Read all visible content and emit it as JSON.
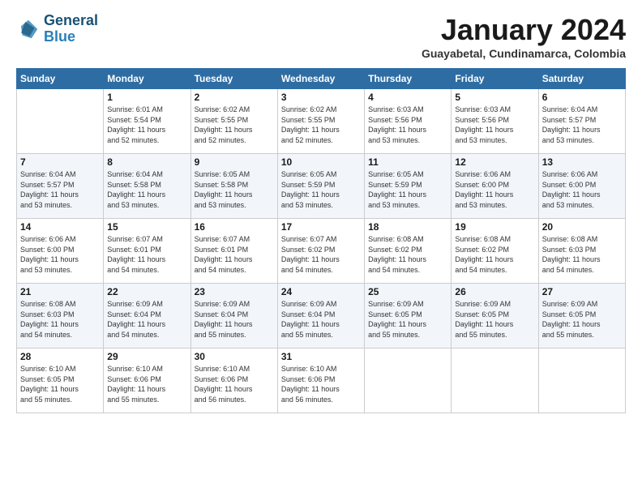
{
  "header": {
    "logo_line1": "General",
    "logo_line2": "Blue",
    "month_title": "January 2024",
    "subtitle": "Guayabetal, Cundinamarca, Colombia"
  },
  "days_of_week": [
    "Sunday",
    "Monday",
    "Tuesday",
    "Wednesday",
    "Thursday",
    "Friday",
    "Saturday"
  ],
  "weeks": [
    [
      {
        "day": "",
        "info": ""
      },
      {
        "day": "1",
        "info": "Sunrise: 6:01 AM\nSunset: 5:54 PM\nDaylight: 11 hours\nand 52 minutes."
      },
      {
        "day": "2",
        "info": "Sunrise: 6:02 AM\nSunset: 5:55 PM\nDaylight: 11 hours\nand 52 minutes."
      },
      {
        "day": "3",
        "info": "Sunrise: 6:02 AM\nSunset: 5:55 PM\nDaylight: 11 hours\nand 52 minutes."
      },
      {
        "day": "4",
        "info": "Sunrise: 6:03 AM\nSunset: 5:56 PM\nDaylight: 11 hours\nand 53 minutes."
      },
      {
        "day": "5",
        "info": "Sunrise: 6:03 AM\nSunset: 5:56 PM\nDaylight: 11 hours\nand 53 minutes."
      },
      {
        "day": "6",
        "info": "Sunrise: 6:04 AM\nSunset: 5:57 PM\nDaylight: 11 hours\nand 53 minutes."
      }
    ],
    [
      {
        "day": "7",
        "info": "Sunrise: 6:04 AM\nSunset: 5:57 PM\nDaylight: 11 hours\nand 53 minutes."
      },
      {
        "day": "8",
        "info": "Sunrise: 6:04 AM\nSunset: 5:58 PM\nDaylight: 11 hours\nand 53 minutes."
      },
      {
        "day": "9",
        "info": "Sunrise: 6:05 AM\nSunset: 5:58 PM\nDaylight: 11 hours\nand 53 minutes."
      },
      {
        "day": "10",
        "info": "Sunrise: 6:05 AM\nSunset: 5:59 PM\nDaylight: 11 hours\nand 53 minutes."
      },
      {
        "day": "11",
        "info": "Sunrise: 6:05 AM\nSunset: 5:59 PM\nDaylight: 11 hours\nand 53 minutes."
      },
      {
        "day": "12",
        "info": "Sunrise: 6:06 AM\nSunset: 6:00 PM\nDaylight: 11 hours\nand 53 minutes."
      },
      {
        "day": "13",
        "info": "Sunrise: 6:06 AM\nSunset: 6:00 PM\nDaylight: 11 hours\nand 53 minutes."
      }
    ],
    [
      {
        "day": "14",
        "info": "Sunrise: 6:06 AM\nSunset: 6:00 PM\nDaylight: 11 hours\nand 53 minutes."
      },
      {
        "day": "15",
        "info": "Sunrise: 6:07 AM\nSunset: 6:01 PM\nDaylight: 11 hours\nand 54 minutes."
      },
      {
        "day": "16",
        "info": "Sunrise: 6:07 AM\nSunset: 6:01 PM\nDaylight: 11 hours\nand 54 minutes."
      },
      {
        "day": "17",
        "info": "Sunrise: 6:07 AM\nSunset: 6:02 PM\nDaylight: 11 hours\nand 54 minutes."
      },
      {
        "day": "18",
        "info": "Sunrise: 6:08 AM\nSunset: 6:02 PM\nDaylight: 11 hours\nand 54 minutes."
      },
      {
        "day": "19",
        "info": "Sunrise: 6:08 AM\nSunset: 6:02 PM\nDaylight: 11 hours\nand 54 minutes."
      },
      {
        "day": "20",
        "info": "Sunrise: 6:08 AM\nSunset: 6:03 PM\nDaylight: 11 hours\nand 54 minutes."
      }
    ],
    [
      {
        "day": "21",
        "info": "Sunrise: 6:08 AM\nSunset: 6:03 PM\nDaylight: 11 hours\nand 54 minutes."
      },
      {
        "day": "22",
        "info": "Sunrise: 6:09 AM\nSunset: 6:04 PM\nDaylight: 11 hours\nand 54 minutes."
      },
      {
        "day": "23",
        "info": "Sunrise: 6:09 AM\nSunset: 6:04 PM\nDaylight: 11 hours\nand 55 minutes."
      },
      {
        "day": "24",
        "info": "Sunrise: 6:09 AM\nSunset: 6:04 PM\nDaylight: 11 hours\nand 55 minutes."
      },
      {
        "day": "25",
        "info": "Sunrise: 6:09 AM\nSunset: 6:05 PM\nDaylight: 11 hours\nand 55 minutes."
      },
      {
        "day": "26",
        "info": "Sunrise: 6:09 AM\nSunset: 6:05 PM\nDaylight: 11 hours\nand 55 minutes."
      },
      {
        "day": "27",
        "info": "Sunrise: 6:09 AM\nSunset: 6:05 PM\nDaylight: 11 hours\nand 55 minutes."
      }
    ],
    [
      {
        "day": "28",
        "info": "Sunrise: 6:10 AM\nSunset: 6:05 PM\nDaylight: 11 hours\nand 55 minutes."
      },
      {
        "day": "29",
        "info": "Sunrise: 6:10 AM\nSunset: 6:06 PM\nDaylight: 11 hours\nand 55 minutes."
      },
      {
        "day": "30",
        "info": "Sunrise: 6:10 AM\nSunset: 6:06 PM\nDaylight: 11 hours\nand 56 minutes."
      },
      {
        "day": "31",
        "info": "Sunrise: 6:10 AM\nSunset: 6:06 PM\nDaylight: 11 hours\nand 56 minutes."
      },
      {
        "day": "",
        "info": ""
      },
      {
        "day": "",
        "info": ""
      },
      {
        "day": "",
        "info": ""
      }
    ]
  ]
}
